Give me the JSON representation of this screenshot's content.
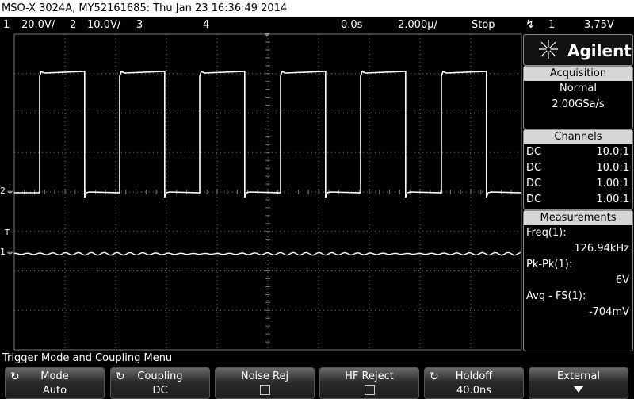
{
  "title_bar": "MSO-X 3024A, MY52161685: Thu Jan 23 16:36:49 2014",
  "status": {
    "ch1_num": "1",
    "ch1_scale": "20.0V/",
    "ch2_num": "2",
    "ch2_scale": "10.0V/",
    "ch3_num": "3",
    "ch4_num": "4",
    "time_delay": "0.0s",
    "time_scale": "2.000µ/",
    "run_state": "Stop",
    "trigger_icon": "trigger-edge-icon",
    "trigger_channel": "1",
    "trigger_level": "3.75V"
  },
  "brand": "Agilent",
  "acquisition": {
    "header": "Acquisition",
    "mode": "Normal",
    "rate": "2.00GSa/s"
  },
  "channels": {
    "header": "Channels",
    "rows": [
      {
        "coupling": "DC",
        "probe": "10.0:1"
      },
      {
        "coupling": "DC",
        "probe": "10.0:1"
      },
      {
        "coupling": "DC",
        "probe": "1.00:1"
      },
      {
        "coupling": "DC",
        "probe": "1.00:1"
      }
    ]
  },
  "measurements": {
    "header": "Measurements",
    "items": [
      {
        "label": "Freq(1):",
        "value": "126.94kHz"
      },
      {
        "label": "Pk-Pk(1):",
        "value": "6V"
      },
      {
        "label": "Avg - FS(1):",
        "value": "-704mV"
      }
    ]
  },
  "markers": {
    "ch2": "2",
    "trig": "T",
    "ch1": "1"
  },
  "menu_title": "Trigger Mode and Coupling Menu",
  "softkeys": [
    {
      "label": "Mode",
      "value": "Auto",
      "icon": "rotate-knob-icon"
    },
    {
      "label": "Coupling",
      "value": "DC",
      "icon": "rotate-knob-icon"
    },
    {
      "label": "Noise Rej",
      "value": "",
      "icon": "checkbox"
    },
    {
      "label": "HF Reject",
      "value": "",
      "icon": "checkbox"
    },
    {
      "label": "Holdoff",
      "value": "40.0ns",
      "icon": "rotate-knob-icon"
    },
    {
      "label": "External",
      "value": "",
      "icon": "arrow-down-icon"
    }
  ],
  "colors": {
    "trace": "#ffffff",
    "grid": "#7a7a7a",
    "panel_header": "#d6d6d6"
  }
}
